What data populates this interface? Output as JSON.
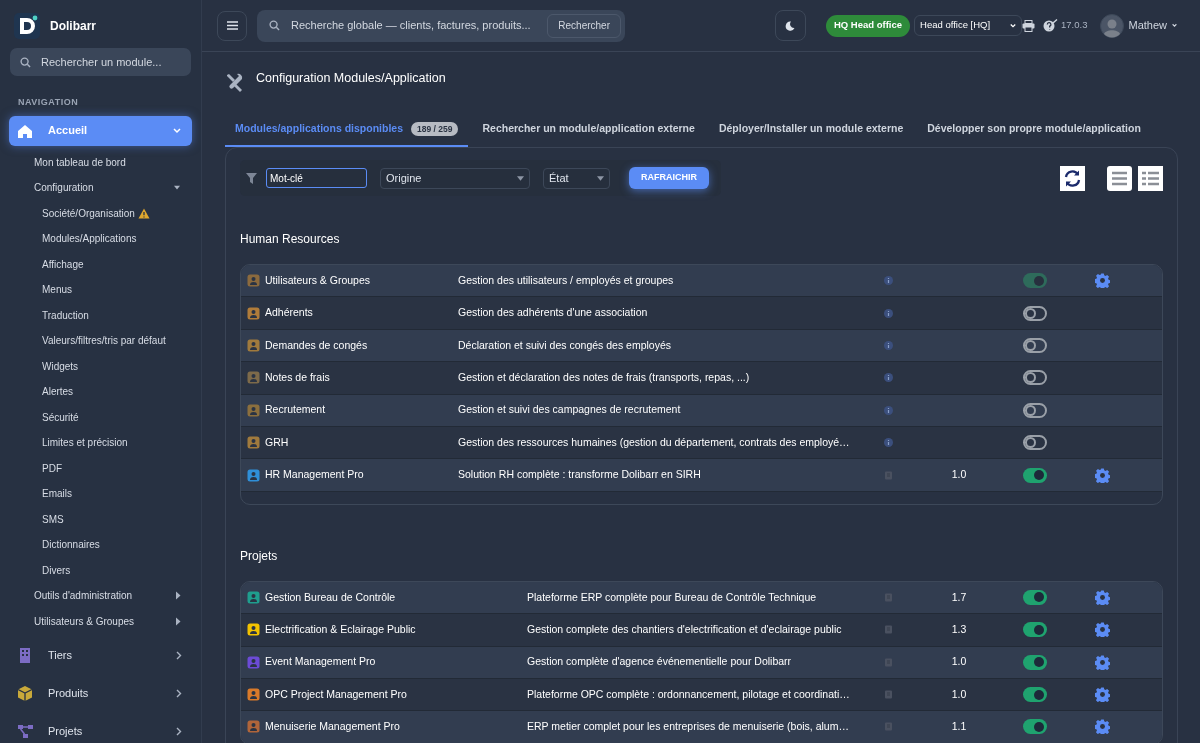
{
  "sidebar": {
    "brand": "Dolibarr",
    "search": {
      "placeholder": "Rechercher un module..."
    },
    "section_label": "NAVIGATION",
    "items": [
      {
        "label": "Accueil",
        "selected": true,
        "expanded": true,
        "children": [
          {
            "label": "Mon tableau de bord",
            "selected": false
          },
          {
            "label": "Configuration",
            "selected": false,
            "expanded": true,
            "children": [
              {
                "label": "Société/Organisation",
                "selected": false,
                "warning": true
              },
              {
                "label": "Modules/Applications",
                "selected": false,
                "warning": false
              },
              {
                "label": "Affichage",
                "selected": false,
                "warning": false
              },
              {
                "label": "Menus",
                "selected": false,
                "warning": false
              },
              {
                "label": "Traduction",
                "selected": false,
                "warning": false
              },
              {
                "label": "Valeurs/filtres/tris par défaut",
                "selected": false,
                "warning": false
              },
              {
                "label": "Widgets",
                "selected": false,
                "warning": false
              },
              {
                "label": "Alertes",
                "selected": false,
                "warning": false
              },
              {
                "label": "Sécurité",
                "selected": false,
                "warning": false
              },
              {
                "label": "Limites et précision",
                "selected": false,
                "warning": false
              },
              {
                "label": "PDF",
                "selected": false,
                "warning": false
              },
              {
                "label": "Emails",
                "selected": false,
                "warning": false
              },
              {
                "label": "SMS",
                "selected": false,
                "warning": false
              },
              {
                "label": "Dictionnaires",
                "selected": false,
                "warning": false
              },
              {
                "label": "Divers",
                "selected": false,
                "warning": false
              }
            ]
          },
          {
            "label": "Outils d'administration",
            "selected": false,
            "expanded": false
          },
          {
            "label": "Utilisateurs & Groupes",
            "selected": false,
            "expanded": false
          }
        ]
      },
      {
        "label": "Tiers",
        "selected": false,
        "expanded": false
      },
      {
        "label": "Produits",
        "selected": false,
        "expanded": false
      },
      {
        "label": "Projets",
        "selected": false,
        "expanded": false
      }
    ]
  },
  "header": {
    "search": {
      "placeholder": "Recherche globale — clients, factures, produits...",
      "button": "Rechercher"
    },
    "entity_badge": "HQ Head office",
    "entity_select": "Head office [HQ]",
    "version": "17.0.3",
    "user": "Mathew"
  },
  "page": {
    "title": "Configuration Modules/Application",
    "tabs": [
      {
        "label": "Modules/applications disponibles",
        "count": "189 / 259",
        "selected": true
      },
      {
        "label": "Rechercher un module/application externe",
        "selected": false
      },
      {
        "label": "Déployer/Installer un module externe",
        "selected": false
      },
      {
        "label": "Développer son propre module/application",
        "selected": false
      }
    ],
    "filters": {
      "keyword": {
        "placeholder": "Mot-clé"
      },
      "origin": "Origine",
      "state": "État",
      "refresh_button": "RAFRAICHIR"
    },
    "sections": [
      {
        "title": "Human Resources",
        "modules": [
          {
            "name": "Utilisateurs & Groupes",
            "description": "Gestion des utilisateurs / employés et groupes",
            "kind": "core",
            "on": true,
            "disabled": true
          },
          {
            "name": "Adhérents",
            "description": "Gestion des adhérents d'une association",
            "kind": "core",
            "on": false,
            "disabled": false
          },
          {
            "name": "Demandes de congés",
            "description": "Déclaration et suivi des congés des employés",
            "kind": "core",
            "on": false,
            "disabled": false
          },
          {
            "name": "Notes de frais",
            "description": "Gestion et déclaration des notes de frais (transports, repas, ...)",
            "kind": "core",
            "on": false,
            "disabled": false
          },
          {
            "name": "Recrutement",
            "description": "Gestion et suivi des campagnes de recrutement",
            "kind": "core",
            "on": false,
            "disabled": false
          },
          {
            "name": "GRH",
            "description": "Gestion des ressources humaines (gestion du département, contrats des employé…",
            "kind": "core",
            "on": false,
            "disabled": false
          },
          {
            "name": "HR Management Pro",
            "description": "Solution RH complète : transforme Dolibarr en SIRH",
            "kind": "external",
            "version": "1.0",
            "on": true,
            "disabled": false
          }
        ]
      },
      {
        "title": "Projets",
        "modules": [
          {
            "name": "Gestion Bureau de Contrôle",
            "description": "Plateforme ERP complète pour Bureau de Contrôle Technique",
            "kind": "external",
            "version": "1.7",
            "on": true,
            "disabled": false
          },
          {
            "name": "Electrification & Eclairage Public",
            "description": "Gestion complete des chantiers d'electrification et d'eclairage public",
            "kind": "external",
            "version": "1.3",
            "on": true,
            "disabled": false
          },
          {
            "name": "Event Management Pro",
            "description": "Gestion complète d'agence événementielle pour Dolibarr",
            "kind": "external",
            "version": "1.0",
            "on": true,
            "disabled": false
          },
          {
            "name": "OPC Project Management Pro",
            "description": "Plateforme OPC complète : ordonnancement, pilotage et coordinati…",
            "kind": "external",
            "version": "1.0",
            "on": true,
            "disabled": false
          },
          {
            "name": "Menuiserie Management Pro",
            "description": "ERP metier complet pour les entreprises de menuiserie (bois, alum…",
            "kind": "external",
            "version": "1.1",
            "on": true,
            "disabled": false
          }
        ]
      }
    ]
  }
}
